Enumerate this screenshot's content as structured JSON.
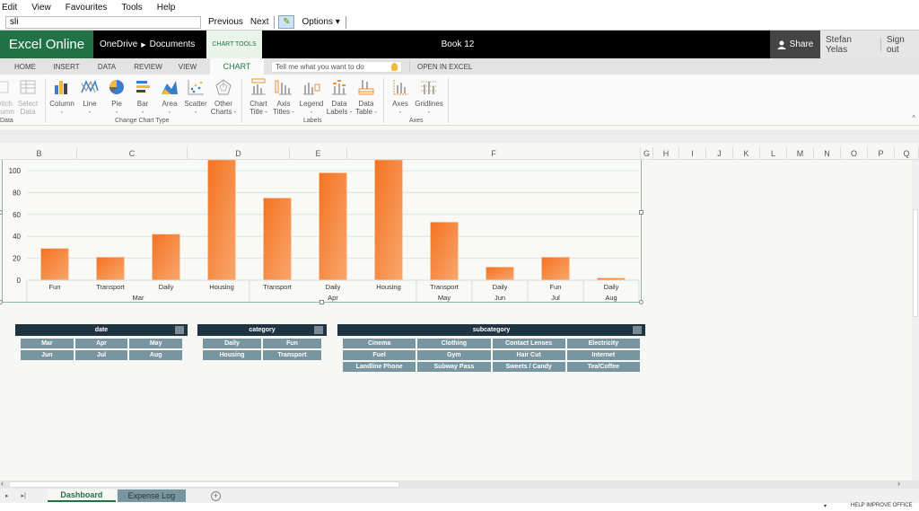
{
  "browser": {
    "menu": [
      "Edit",
      "View",
      "Favourites",
      "Tools",
      "Help"
    ],
    "find_value": "sli",
    "find_previous": "Previous",
    "find_next": "Next",
    "options_label": "Options"
  },
  "header": {
    "brand": "Excel Online",
    "breadcrumb_root": "OneDrive",
    "breadcrumb_folder": "Documents",
    "context_tab": "CHART TOOLS",
    "book_title": "Book 12",
    "share": "Share",
    "user": "Stefan Yelas",
    "sign_out": "Sign out"
  },
  "tabs": [
    "HOME",
    "INSERT",
    "DATA",
    "REVIEW",
    "VIEW",
    "CHART"
  ],
  "active_tab": "CHART",
  "tell_me_placeholder": "Tell me what you want to do",
  "open_in_excel": "OPEN IN EXCEL",
  "ribbon": {
    "data_group": {
      "label": "Data",
      "buttons": [
        {
          "l1": "Switch",
          "l2": "Column"
        },
        {
          "l1": "Select",
          "l2": "Data"
        }
      ]
    },
    "type_group": {
      "label": "Change Chart Type",
      "buttons": [
        {
          "l1": "Column",
          "l2": "-"
        },
        {
          "l1": "Line",
          "l2": "-"
        },
        {
          "l1": "Pie",
          "l2": "-"
        },
        {
          "l1": "Bar",
          "l2": "-"
        },
        {
          "l1": "Area",
          "l2": "-"
        },
        {
          "l1": "Scatter",
          "l2": "-"
        },
        {
          "l1": "Other",
          "l2": "Charts -"
        }
      ]
    },
    "labels_group": {
      "label": "Labels",
      "buttons": [
        {
          "l1": "Chart",
          "l2": "Title -"
        },
        {
          "l1": "Axis",
          "l2": "Titles -"
        },
        {
          "l1": "Legend",
          "l2": "-"
        },
        {
          "l1": "Data",
          "l2": "Labels -"
        },
        {
          "l1": "Data",
          "l2": "Table -"
        }
      ]
    },
    "axes_group": {
      "label": "Axes",
      "buttons": [
        {
          "l1": "Axes",
          "l2": "-"
        },
        {
          "l1": "Gridlines",
          "l2": "-"
        }
      ]
    }
  },
  "columns": [
    "B",
    "C",
    "D",
    "E",
    "F",
    "G",
    "H",
    "I",
    "J",
    "K",
    "L",
    "M",
    "N",
    "O",
    "P",
    "Q"
  ],
  "chart_data": {
    "type": "bar",
    "title": "",
    "xlabel": "",
    "ylabel": "",
    "ylim": [
      0,
      110
    ],
    "yticks": [
      0,
      20,
      40,
      60,
      80,
      100
    ],
    "grid": true,
    "legend": "none",
    "bar_color": "#f47c30",
    "categories": [
      "Fun",
      "Transport",
      "Daily",
      "Housing",
      "Transport",
      "Daily",
      "Housing",
      "Transport",
      "Daily",
      "Fun",
      "Daily"
    ],
    "groups": [
      {
        "name": "Mar",
        "count": 4
      },
      {
        "name": "Apr",
        "count": 3
      },
      {
        "name": "May",
        "count": 1
      },
      {
        "name": "Jun",
        "count": 1
      },
      {
        "name": "Jul",
        "count": 1
      },
      {
        "name": "Aug",
        "count": 1
      }
    ],
    "values": [
      29,
      21,
      42,
      110,
      75,
      98,
      110,
      53,
      12,
      21,
      2
    ]
  },
  "slicers": {
    "date": {
      "title": "date",
      "items": [
        "Mar",
        "Apr",
        "May",
        "Jun",
        "Jul",
        "Aug"
      ]
    },
    "category": {
      "title": "category",
      "items": [
        "Daily",
        "Fun",
        "Housing",
        "Transport"
      ]
    },
    "subcategory": {
      "title": "subcategory",
      "items": [
        "Cinema",
        "Clothing",
        "Contact Lenses",
        "Electricity",
        "Fuel",
        "Gym",
        "Hair Cut",
        "Internet",
        "Landline Phone",
        "Subway Pass",
        "Sweets / Candy",
        "Tea/Coffee"
      ]
    }
  },
  "sheets": [
    "Dashboard",
    "Expense Log"
  ],
  "active_sheet": "Dashboard",
  "status_text": "HELP IMPROVE OFFICE"
}
